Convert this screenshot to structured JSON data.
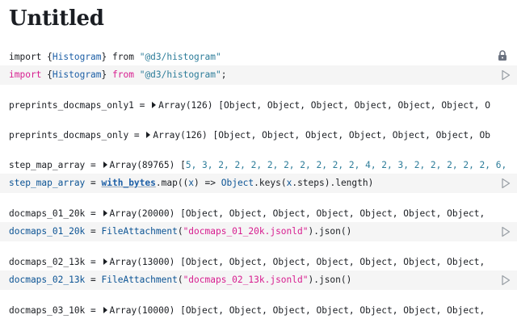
{
  "notebook": {
    "title": "Untitled"
  },
  "cells": {
    "c1": {
      "output": {
        "kw": "import",
        "o": " {",
        "name": "Histogram",
        "c": "}",
        "from": " from ",
        "src": "\"@d3/histogram\""
      },
      "source": {
        "kw": "import",
        "o": " {",
        "name": "Histogram",
        "c": "}",
        "from": " from ",
        "src": "\"@d3/histogram\"",
        "semi": ";"
      }
    },
    "c2": {
      "output": {
        "name": "preprints_docmaps_only1",
        "eq": " = ",
        "type": "Array(126)",
        "val": " [Object, Object, Object, Object, Object, Object, O"
      }
    },
    "c3": {
      "output": {
        "name": "preprints_docmaps_only",
        "eq": " = ",
        "type": "Array(126)",
        "val": " [Object, Object, Object, Object, Object, Object, Ob"
      }
    },
    "c4": {
      "output": {
        "name": "step_map_array",
        "eq": " = ",
        "type": "Array(89765)",
        "open": " [",
        "values": "5, 3, 2, 2, 2, 2, 2, 2, 2, 2, 2, 4, 2, 3, 2, 2, 2, 2, 2, 6, …",
        "close": "]"
      },
      "source": {
        "name": "step_map_array",
        "eq": " = ",
        "ref": "with_bytes",
        "p1": ".map((",
        "arg": "x",
        "p2": ") => ",
        "obj": "Object",
        "p3": ".keys(",
        "arg2": "x",
        "p4": ".steps).length)"
      }
    },
    "c5": {
      "output": {
        "name": "docmaps_01_20k",
        "eq": " = ",
        "type": "Array(20000)",
        "val": " [Object, Object, Object, Object, Object, Object, Object,"
      },
      "source": {
        "name": "docmaps_01_20k",
        "eq": " = ",
        "fn": "FileAttachment",
        "p1": "(",
        "str": "\"docmaps_01_20k.jsonld\"",
        "p2": ").json()"
      }
    },
    "c6": {
      "output": {
        "name": "docmaps_02_13k",
        "eq": " = ",
        "type": "Array(13000)",
        "val": " [Object, Object, Object, Object, Object, Object, Object,"
      },
      "source": {
        "name": "docmaps_02_13k",
        "eq": " = ",
        "fn": "FileAttachment",
        "p1": "(",
        "str": "\"docmaps_02_13k.jsonld\"",
        "p2": ").json()"
      }
    },
    "c7": {
      "output": {
        "name": "docmaps_03_10k",
        "eq": " = ",
        "type": "Array(10000)",
        "val": " [Object, Object, Object, Object, Object, Object, Object,"
      }
    }
  },
  "colors": {
    "keyword": "#d71d8f",
    "string": "#2e7d9a",
    "definition": "#1d5fa6",
    "source_bg": "#f5f5f5"
  },
  "icons": {
    "lock": "lock-icon",
    "run": "play-icon"
  }
}
